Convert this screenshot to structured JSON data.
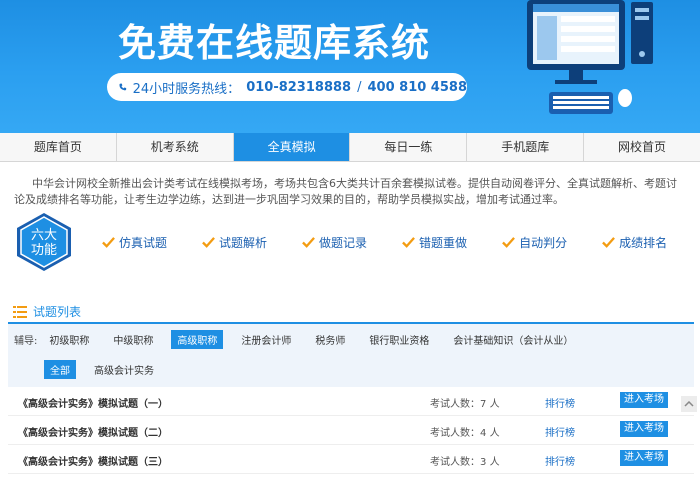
{
  "banner": {
    "title": "免费在线题库系统",
    "hotline_label": "24小时服务热线：",
    "hotline_1": "010-82318888",
    "hotline_sep": "/",
    "hotline_2": "400 810 4588"
  },
  "nav": {
    "items": [
      {
        "label": "题库首页"
      },
      {
        "label": "机考系统"
      },
      {
        "label": "全真模拟"
      },
      {
        "label": "每日一练"
      },
      {
        "label": "手机题库"
      },
      {
        "label": "网校首页"
      }
    ],
    "active_index": 2
  },
  "intro": "中华会计网校全新推出会计类考试在线模拟考场，考场共包含6大类共计百余套模拟试卷。提供自动阅卷评分、全真试题解析、考题讨论及成绩排名等功能，让考生边学边练，达到进一步巩固学习效果的目的，帮助学员模拟实战，增加考试通过率。",
  "features": {
    "badge_line1": "六大",
    "badge_line2": "功能",
    "items": [
      {
        "label": "仿真试题"
      },
      {
        "label": "试题解析"
      },
      {
        "label": "做题记录"
      },
      {
        "label": "错题重做"
      },
      {
        "label": "自动判分"
      },
      {
        "label": "成绩排名"
      }
    ]
  },
  "list": {
    "heading": "试题列表",
    "filter_label": "辅导:",
    "filters": [
      {
        "label": "初级职称"
      },
      {
        "label": "中级职称"
      },
      {
        "label": "高级职称"
      },
      {
        "label": "注册会计师"
      },
      {
        "label": "税务师"
      },
      {
        "label": "银行职业资格"
      },
      {
        "label": "会计基础知识（会计从业）"
      }
    ],
    "active_filter": "高级职称",
    "subfilters": [
      {
        "label": "全部"
      },
      {
        "label": "高级会计实务"
      }
    ],
    "active_subfilter": "全部",
    "exams": [
      {
        "title": "《高级会计实务》模拟试题（一）",
        "count_label": "考试人数：",
        "count": "7",
        "unit": "人",
        "rank": "排行榜",
        "action": "进入考场"
      },
      {
        "title": "《高级会计实务》模拟试题（二）",
        "count_label": "考试人数：",
        "count": "4",
        "unit": "人",
        "rank": "排行榜",
        "action": "进入考场"
      },
      {
        "title": "《高级会计实务》模拟试题（三）",
        "count_label": "考试人数：",
        "count": "3",
        "unit": "人",
        "rank": "排行榜",
        "action": "进入考场"
      }
    ]
  },
  "colors": {
    "brand_blue": "#1e8fe3",
    "feature_text": "#1a5fb0",
    "check_orange": "#f39c12",
    "filter_bg": "#eef4fb"
  }
}
